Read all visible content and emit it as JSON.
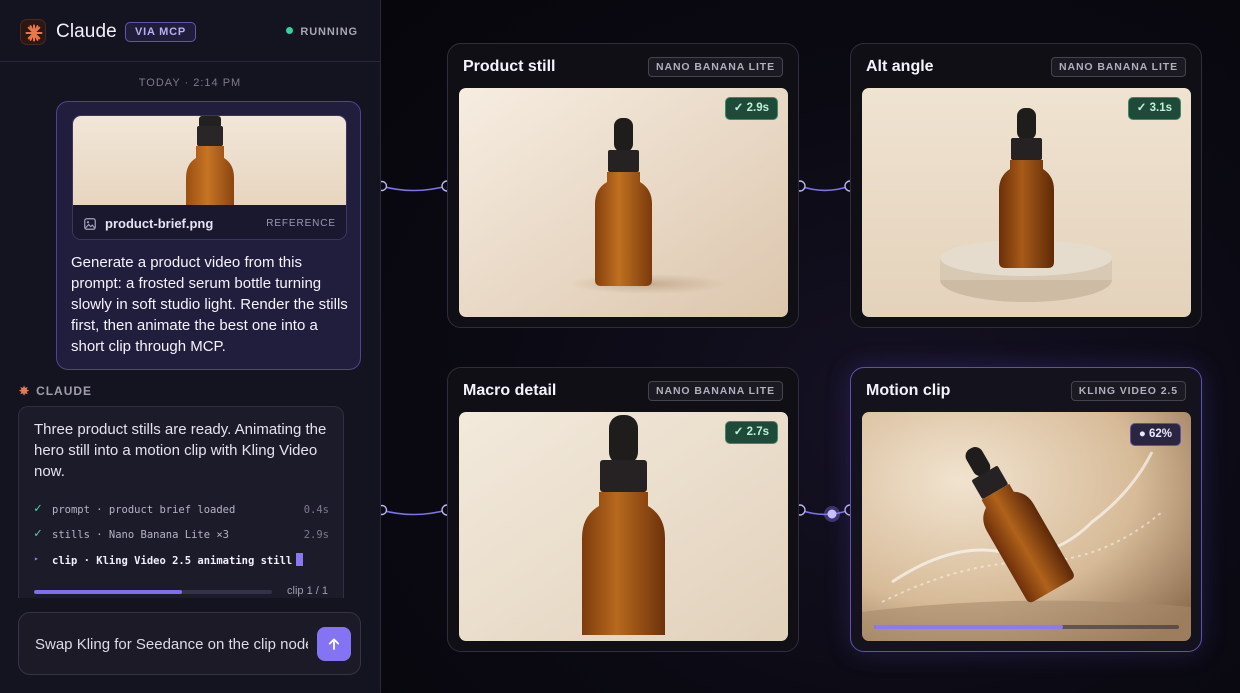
{
  "header": {
    "app_name": "Claude",
    "via_badge": "VIA MCP",
    "status": "RUNNING",
    "logo_icon": "claude-starburst-icon",
    "status_color": "#34d399"
  },
  "chat": {
    "timestamp": "TODAY · 2:14 PM",
    "user_message": {
      "attachment": {
        "file_name": "product-brief.png",
        "tag": "REFERENCE",
        "icon": "image-file-icon"
      },
      "text": "Generate a product video from this prompt: a frosted serum bottle turning slowly in soft studio light. Render the stills first, then animate the best one into a short clip through MCP."
    },
    "assistant": {
      "label": "CLAUDE",
      "text": "Three product stills are ready. Animating the hero still into a motion clip with Kling Video now.",
      "steps": [
        {
          "status": "done",
          "text": "prompt · product brief loaded",
          "time": "0.4s"
        },
        {
          "status": "done",
          "text": "stills · Nano Banana Lite ×3",
          "time": "2.9s"
        },
        {
          "status": "running",
          "text": "clip · Kling Video 2.5 animating still",
          "time": ""
        }
      ],
      "progress_fraction": 0.62,
      "clip_count": "clip 1 / 1"
    },
    "composer": {
      "value": "Swap Kling for Seedance on the clip node",
      "send_icon": "arrow-up-icon"
    }
  },
  "canvas": {
    "nodes": [
      {
        "title": "Product still",
        "model": "NANO BANANA LITE",
        "badge": "✓ 2.9s"
      },
      {
        "title": "Alt angle",
        "model": "NANO BANANA LITE",
        "badge": "✓ 3.1s"
      },
      {
        "title": "Macro detail",
        "model": "NANO BANANA LITE",
        "badge": "✓ 2.7s"
      },
      {
        "title": "Motion clip",
        "model": "KLING VIDEO 2.5",
        "badge": "● 62%",
        "progress_fraction": 0.62
      }
    ]
  },
  "colors": {
    "accent": "#8473f2",
    "success": "#4fd29a",
    "panel_bg": "#141320",
    "canvas_bg": "#0b0a13"
  }
}
